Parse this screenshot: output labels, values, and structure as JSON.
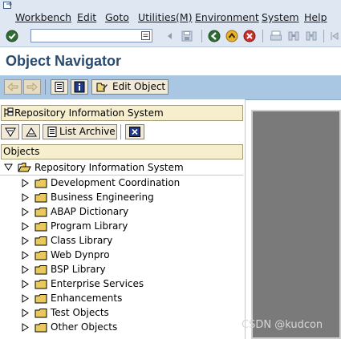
{
  "menu": {
    "items": [
      {
        "label": "Workbench"
      },
      {
        "label": "Edit"
      },
      {
        "label": "Goto"
      },
      {
        "label": "Utilities(M)"
      },
      {
        "label": "Environment"
      },
      {
        "label": "System"
      },
      {
        "label": "Help"
      }
    ]
  },
  "toolbar": {
    "command_value": "",
    "icons": [
      "enter-check-icon",
      "back-icon",
      "save-icon",
      "back-green-icon",
      "exit-icon",
      "cancel-icon",
      "print-icon",
      "find-icon",
      "find-next-icon"
    ]
  },
  "page": {
    "title": "Object Navigator"
  },
  "app_toolbar": {
    "edit_object_label": "Edit Object",
    "icons": [
      "back-arrow-icon",
      "forward-arrow-icon",
      "object-list-icon",
      "info-icon",
      "edit-object-icon"
    ]
  },
  "navigator": {
    "header_title": "Repository Information System",
    "list_archive_label": "List Archive",
    "objects_header": "Objects",
    "tree_root": "Repository Information System",
    "tree_items": [
      {
        "label": "Development Coordination"
      },
      {
        "label": "Business Engineering"
      },
      {
        "label": "ABAP Dictionary"
      },
      {
        "label": "Program Library"
      },
      {
        "label": "Class Library"
      },
      {
        "label": "Web Dynpro"
      },
      {
        "label": "BSP Library"
      },
      {
        "label": "Enterprise Services"
      },
      {
        "label": "Enhancements"
      },
      {
        "label": "Test Objects"
      },
      {
        "label": "Other Objects"
      }
    ]
  },
  "colors": {
    "menubar_bg": "#dfe7f3",
    "app_toolbar_bg": "#a9c6e2",
    "header_bg": "#f6eecd",
    "title_color": "#2a4a6e",
    "folder_color": "#e9c85c"
  },
  "watermark": "CSDN @kudcon"
}
